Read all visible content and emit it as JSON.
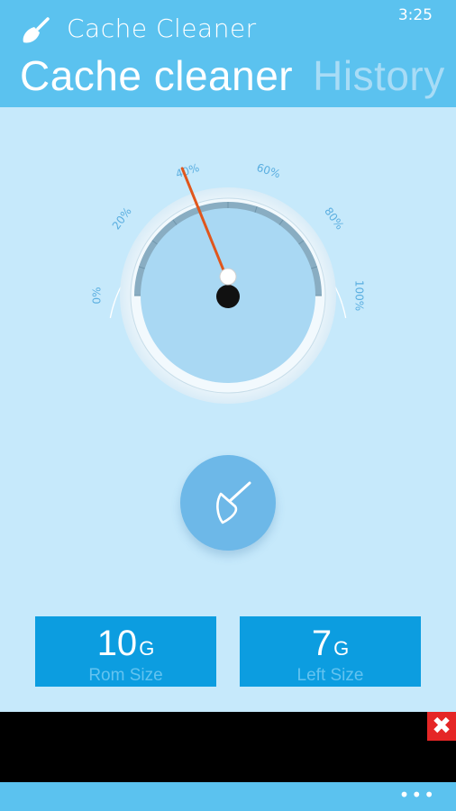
{
  "status_bar": {
    "time": "3:25"
  },
  "app": {
    "title": "Cache Cleaner",
    "icon": "broom-icon"
  },
  "pivot": {
    "tabs": [
      "Cache cleaner",
      "History"
    ],
    "active": 0
  },
  "gauge": {
    "labels": [
      "0%",
      "20%",
      "40%",
      "60%",
      "80%",
      "100%"
    ],
    "value_percent": 40,
    "needle_color": "#e0561c"
  },
  "clean_button": {
    "icon": "broom-icon"
  },
  "stats": {
    "rom": {
      "value": "10",
      "unit": "G",
      "label": "Rom Size"
    },
    "left": {
      "value": "7",
      "unit": "G",
      "label": "Left Size"
    }
  },
  "ad": {
    "close_symbol": "✖"
  },
  "app_bar": {
    "more_label": "•••"
  },
  "colors": {
    "accent": "#5bc2ef",
    "tile": "#0c9de0",
    "background": "#c6e9fb",
    "close": "#e52626"
  }
}
